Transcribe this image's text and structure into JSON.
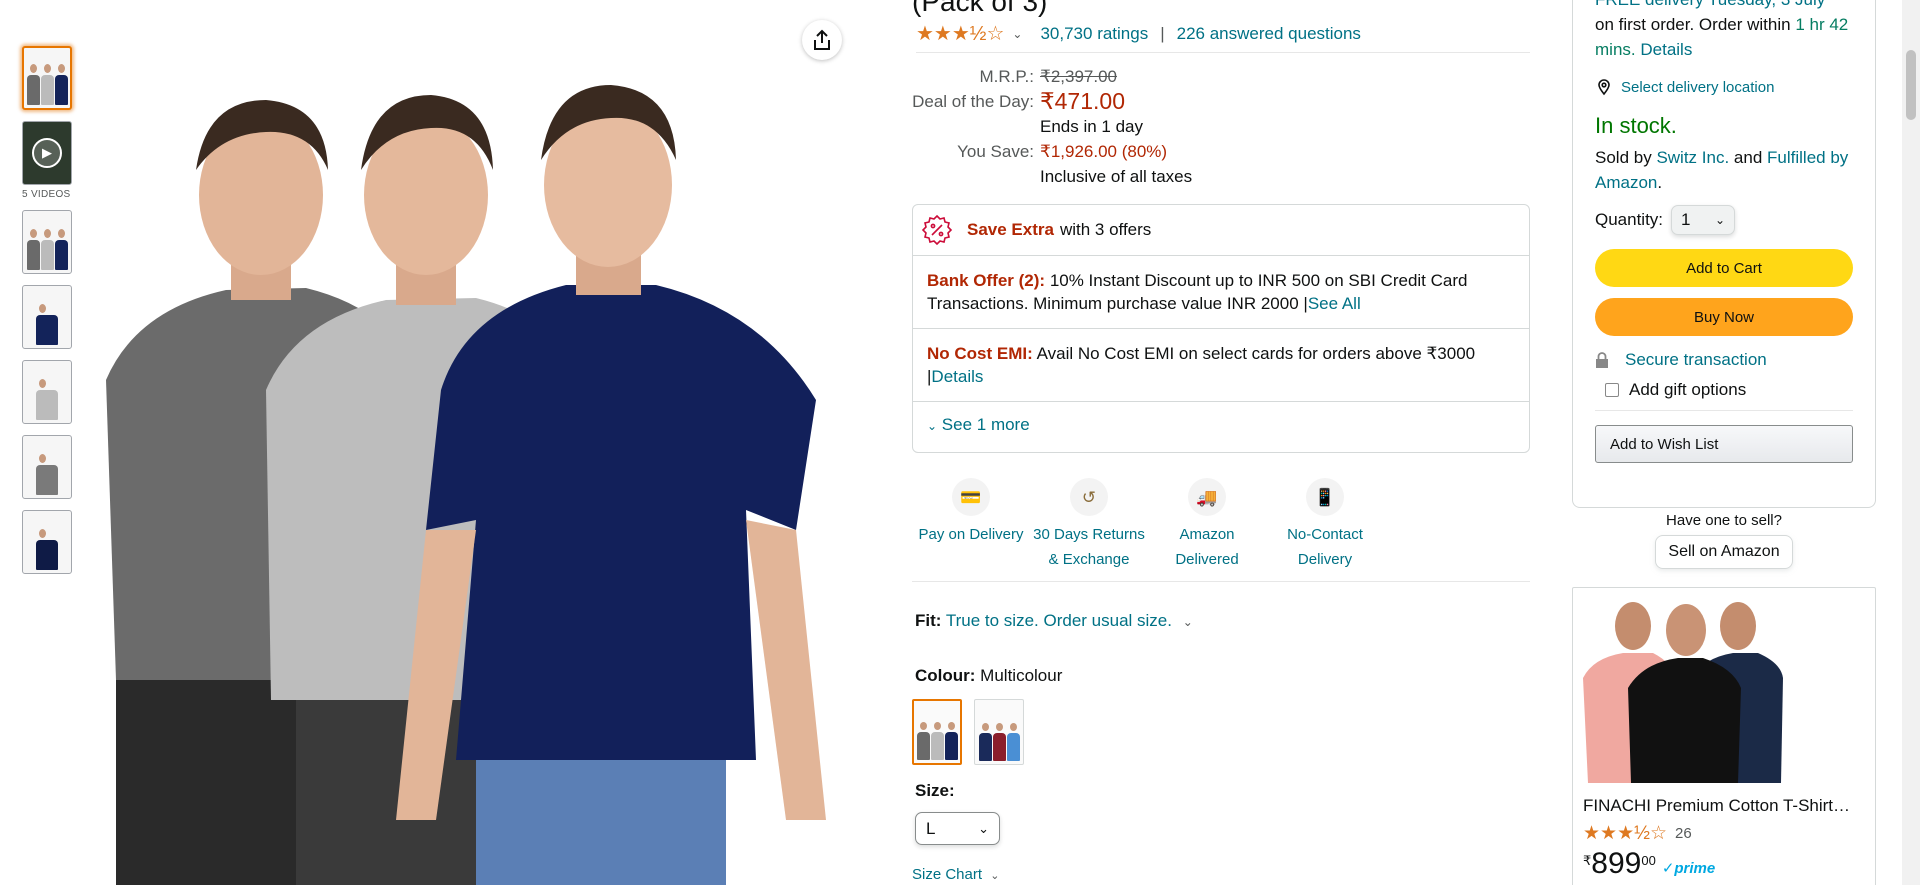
{
  "product": {
    "title_fragment": "(Pack of 3)",
    "rating_stars": "★★★½☆",
    "ratings_count": "30,730 ratings",
    "separator": "|",
    "answered_questions": "226 answered questions"
  },
  "gallery": {
    "videos_label": "5 VIDEOS"
  },
  "pricing": {
    "mrp_label": "M.R.P.:",
    "mrp_value": "₹2,397.00",
    "deal_label": "Deal of the Day:",
    "deal_price": "₹471.00",
    "ends_text": "Ends in 1 day",
    "save_label": "You Save:",
    "save_value": "₹1,926.00 (80%)",
    "tax_note": "Inclusive of all taxes"
  },
  "offers": {
    "header_strong": "Save Extra",
    "header_rest": "with 3 offers",
    "items": [
      {
        "title": "Bank Offer (2):",
        "text": "10% Instant Discount up to INR 500 on SBI Credit Card Transactions. Minimum purchase value INR 2000",
        "pipe": "|",
        "link": "See All"
      },
      {
        "title": "No Cost EMI:",
        "text": "Avail No Cost EMI on select cards for orders above ₹3000",
        "pipe": "|",
        "link": "Details"
      }
    ],
    "see_more": "See 1 more"
  },
  "features": [
    {
      "icon": "cash-delivery-icon",
      "line1": "Pay on Delivery",
      "line2": ""
    },
    {
      "icon": "returns-icon",
      "line1": "30 Days Returns",
      "line2": "& Exchange"
    },
    {
      "icon": "delivery-truck-icon",
      "line1": "Amazon",
      "line2": "Delivered"
    },
    {
      "icon": "contactless-icon",
      "line1": "No-Contact",
      "line2": "Delivery"
    }
  ],
  "fit": {
    "label": "Fit:",
    "value": "True to size. Order usual size."
  },
  "colour": {
    "label": "Colour:",
    "value": "Multicolour"
  },
  "size": {
    "label": "Size:",
    "selected": "L",
    "chart_link": "Size Chart"
  },
  "buybox": {
    "delivery_line1": "FREE delivery Tuesday, 3 July",
    "delivery_line2": "on first order. Order within",
    "countdown": "1 hr 42 mins.",
    "details_link": "Details",
    "location_link": "Select delivery location",
    "stock": "In stock.",
    "sold_by_prefix": "Sold by",
    "seller": "Switz Inc.",
    "and": "and",
    "fulfilled": "Fulfilled by Amazon",
    "period": ".",
    "qty_label": "Quantity:",
    "qty_value": "1",
    "add_to_cart": "Add to Cart",
    "buy_now": "Buy Now",
    "secure": "Secure transaction",
    "gift": "Add gift options",
    "wishlist": "Add to Wish List"
  },
  "sell": {
    "prompt": "Have one to sell?",
    "button": "Sell on Amazon"
  },
  "ad": {
    "title": "FINACHI Premium Cotton T-Shirt…",
    "stars": "★★★½☆",
    "rating_count": "26",
    "currency": "₹",
    "price_whole": "899",
    "price_fraction": "00",
    "prime": "✓prime"
  },
  "colors": {
    "accent_link": "#007185",
    "price_red": "#b12704",
    "cart_yellow": "#ffd814",
    "buy_orange": "#ffa41c",
    "stock_green": "#007600",
    "star_orange": "#de7921"
  }
}
